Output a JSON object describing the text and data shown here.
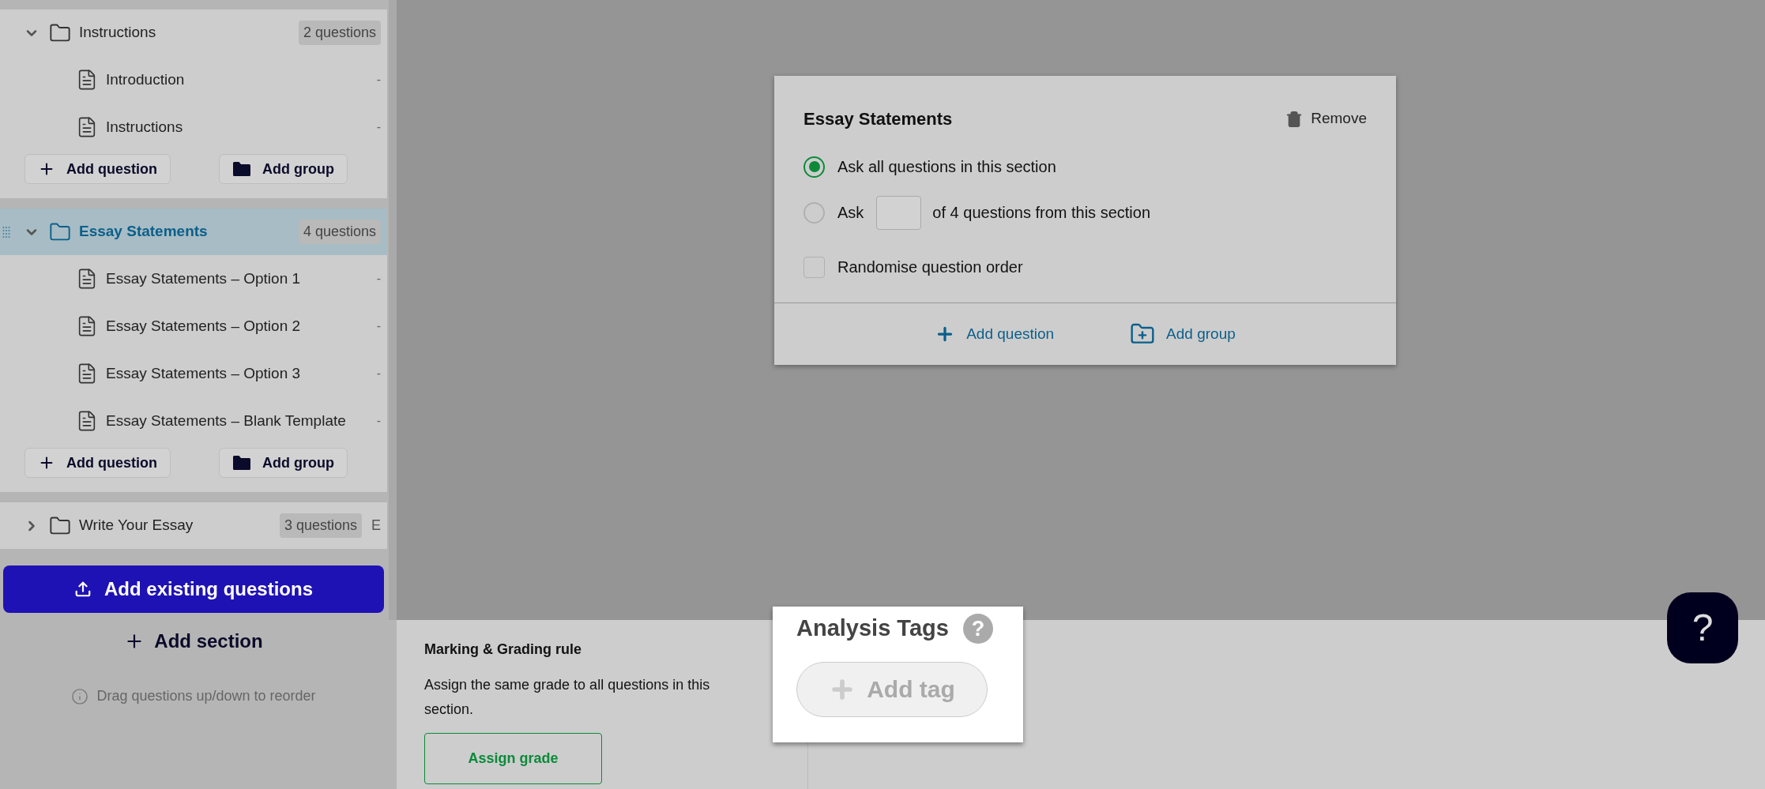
{
  "sections": [
    {
      "title": "Instructions",
      "count": "2 questions",
      "expanded": true,
      "selected": false,
      "items": [
        {
          "label": "Introduction",
          "trailing": "-"
        },
        {
          "label": "Instructions",
          "trailing": "-"
        }
      ],
      "buttons": [
        "Add question",
        "Add group"
      ]
    },
    {
      "title": "Essay Statements",
      "count": "4 questions",
      "expanded": true,
      "selected": true,
      "items": [
        {
          "label": "Essay Statements – Option 1",
          "trailing": "-"
        },
        {
          "label": "Essay Statements – Option 2",
          "trailing": "-"
        },
        {
          "label": "Essay Statements – Option 3",
          "trailing": "-"
        },
        {
          "label": "Essay Statements – Blank Template",
          "trailing": "-"
        }
      ],
      "buttons": [
        "Add question",
        "Add group"
      ]
    },
    {
      "title": "Write Your Essay",
      "count": "3 questions",
      "expanded": false,
      "selected": false,
      "trailing": "E"
    }
  ],
  "add_existing": "Add existing questions",
  "add_section": "Add section",
  "hint": "Drag questions up/down to reorder",
  "dialog": {
    "title": "Essay Statements",
    "remove": "Remove",
    "options": [
      {
        "kind": "all",
        "label": "Ask all questions in this section",
        "selected": true
      },
      {
        "kind": "some",
        "label": "Ask",
        "suffix": "of 4 questions from this section",
        "selected": false
      }
    ],
    "randomise": {
      "label": "Randomise question order",
      "checked": false
    },
    "footer": [
      "Add question",
      "Add group"
    ]
  },
  "marking": {
    "title": "Marking & Grading rule",
    "text": "Assign the same grade to all questions in this section.",
    "button": "Assign grade"
  },
  "tags": {
    "title": "Analysis Tags",
    "help": "?",
    "button": "Add tag"
  },
  "help_button": "?"
}
